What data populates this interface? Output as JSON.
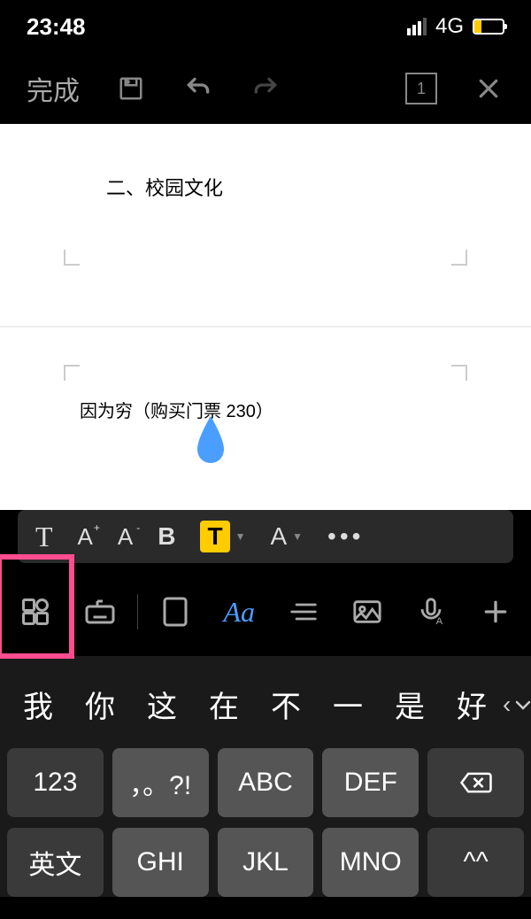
{
  "status": {
    "time": "23:48",
    "network": "4G"
  },
  "toolbar": {
    "done": "完成",
    "page": "1"
  },
  "document": {
    "line1": "二、校园文化",
    "line2": "因为穷（购买门票 230）"
  },
  "format": {
    "t": "T",
    "a_plus": "A",
    "a_plus_sup": "+",
    "a_minus": "A",
    "a_minus_sup": "-",
    "bold": "B",
    "highlight": "T",
    "font_color": "A",
    "more": "•••"
  },
  "bottom": {
    "font_label": "Aa"
  },
  "candidates": [
    "我",
    "你",
    "这",
    "在",
    "不",
    "一",
    "是",
    "好"
  ],
  "cand_extra": "‹",
  "keys": {
    "r1c1": "123",
    "r1c2": "，。?!",
    "r1c3": "ABC",
    "r1c4": "DEF",
    "r2c1": "英文",
    "r2c2": "GHI",
    "r2c3": "JKL",
    "r2c4": "MNO",
    "emoji": "^^"
  }
}
